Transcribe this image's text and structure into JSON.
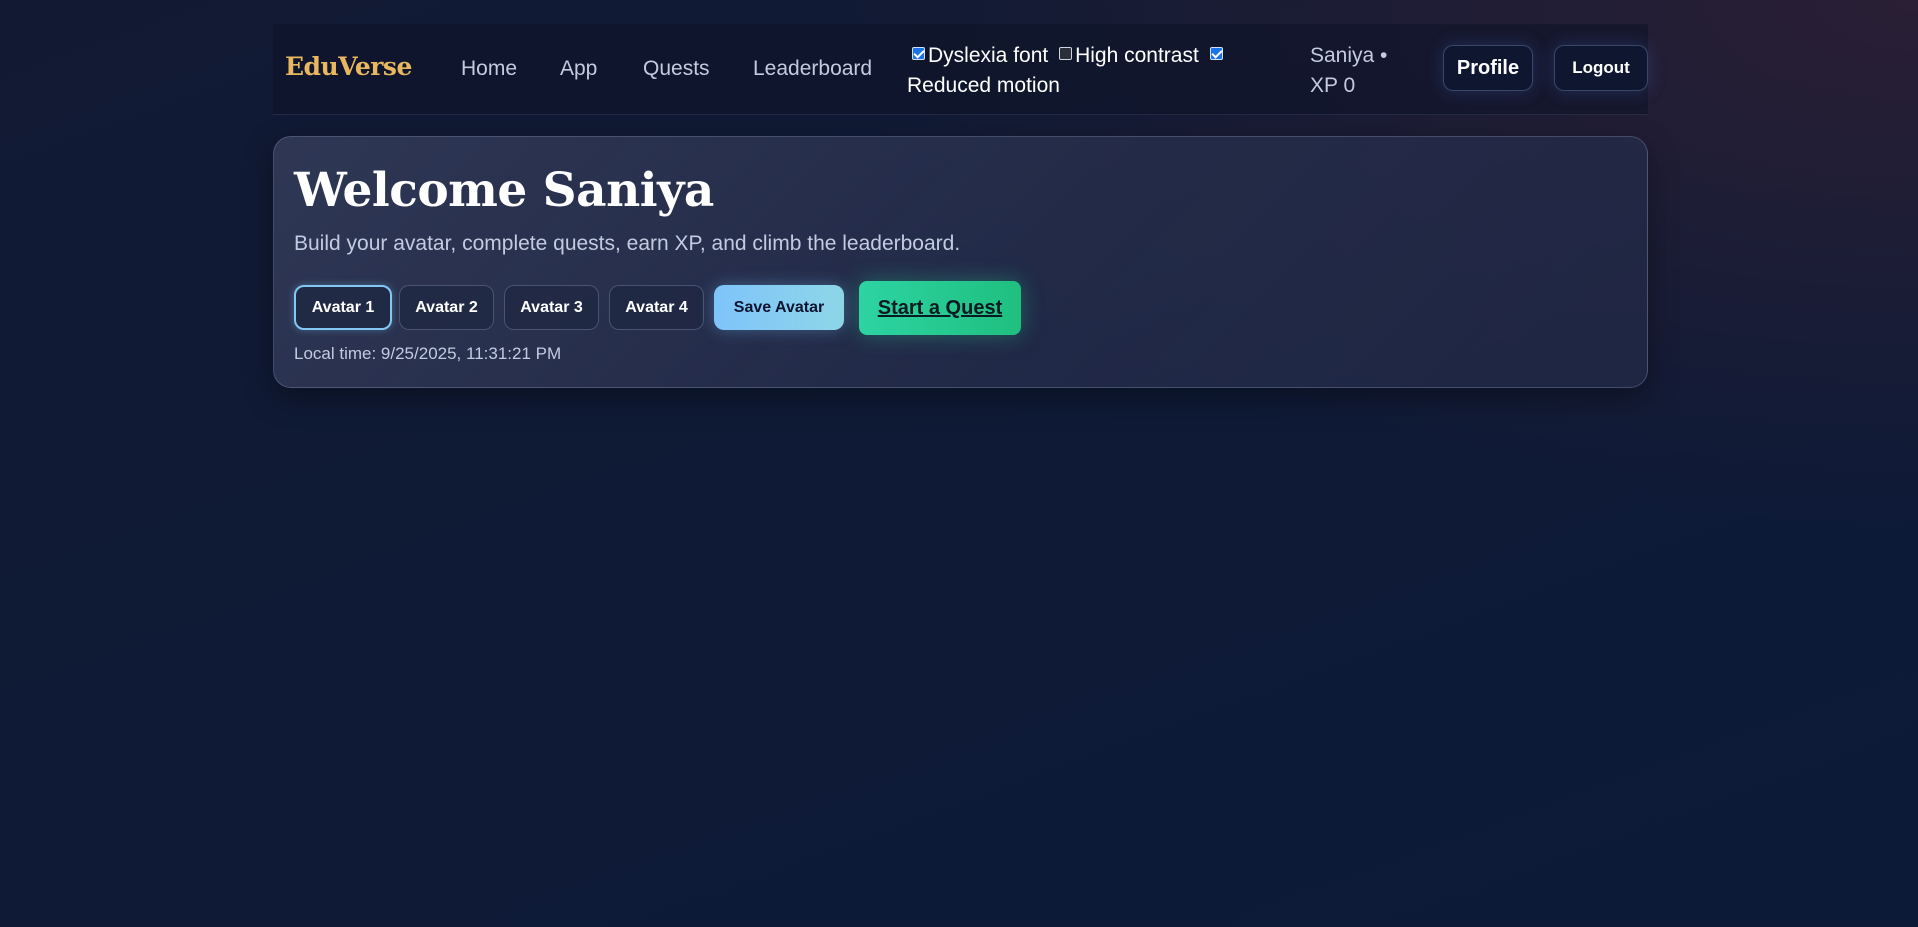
{
  "nav": {
    "brand": "EduVerse",
    "links": [
      "Home",
      "App",
      "Quests",
      "Leaderboard"
    ],
    "toggles": [
      {
        "label": "Dyslexia font",
        "checked": true
      },
      {
        "label": "High contrast",
        "checked": false
      },
      {
        "label": "Reduced motion",
        "checked": true
      }
    ],
    "user_text": "Saniya •",
    "xp_text": "XP 0",
    "profile_label": "Profile",
    "logout_label": "Logout"
  },
  "welcome": {
    "title": "Welcome Saniya",
    "subtitle": "Build your avatar, complete quests, earn XP, and climb the leaderboard.",
    "avatars": [
      "Avatar 1",
      "Avatar 2",
      "Avatar 3",
      "Avatar 4"
    ],
    "selected_avatar": "Avatar 1",
    "save_label": "Save Avatar",
    "quest_label": "Start a Quest",
    "local_time": "Local time: 9/25/2025, 11:31:21 PM"
  },
  "colors": {
    "brand": "#e8b75f",
    "save_button": "#7ec4fb",
    "quest_button": "#2dd4a2",
    "checkbox_on": "#1a73e8"
  }
}
